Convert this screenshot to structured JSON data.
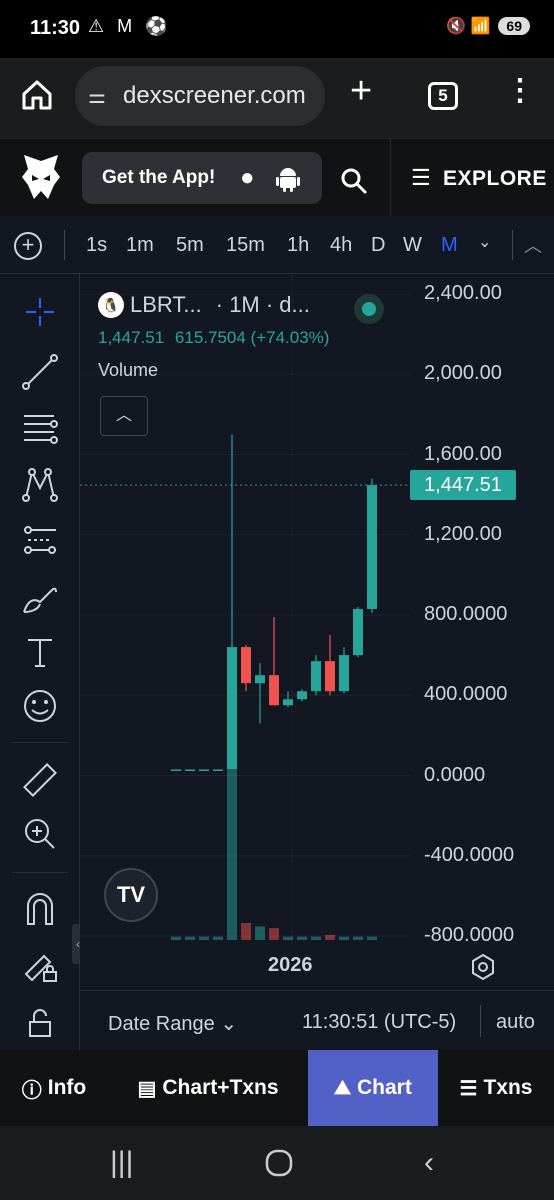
{
  "status_bar": {
    "time": "11:30",
    "notification_icons": "⚠ M ⚽",
    "right_icons": "🔇 📶",
    "network_sup": "6",
    "battery": "69"
  },
  "browser": {
    "url": "dexscreener.com",
    "tab_count": "5"
  },
  "app_header": {
    "get_app_label": "Get the App!",
    "explore_label": "EXPLORE"
  },
  "timeframes": [
    {
      "label": "1s",
      "active": false
    },
    {
      "label": "1m",
      "active": false
    },
    {
      "label": "5m",
      "active": false
    },
    {
      "label": "15m",
      "active": false
    },
    {
      "label": "1h",
      "active": false
    },
    {
      "label": "4h",
      "active": false
    },
    {
      "label": "D",
      "active": false
    },
    {
      "label": "W",
      "active": false
    },
    {
      "label": "M",
      "active": true
    }
  ],
  "legend": {
    "symbol": "LBRT...",
    "interval_text": "· 1M · d...",
    "price": "1,447.51",
    "change": "615.7504 (+74.03%)",
    "volume_label": "Volume"
  },
  "colors": {
    "up": "#26a69a",
    "down": "#ef5350",
    "background": "#131722",
    "active_tab": "#5161c6"
  },
  "chart_data": {
    "type": "candlestick",
    "price_axis_ticks": [
      "2,400.00",
      "2,000.00",
      "1,600.00",
      "1,200.00",
      "800.0000",
      "400.0000",
      "0.0000",
      "-400.0000",
      "-800.0000"
    ],
    "last_price_label": "1,447.51",
    "x_axis_label": "2026",
    "ylim": [
      -800,
      2400
    ],
    "candles": [
      {
        "o": 30,
        "h": 30,
        "l": 30,
        "c": 30
      },
      {
        "o": 30,
        "h": 30,
        "l": 30,
        "c": 30
      },
      {
        "o": 30,
        "h": 30,
        "l": 30,
        "c": 30
      },
      {
        "o": 30,
        "h": 30,
        "l": 30,
        "c": 30
      },
      {
        "o": 30,
        "h": 1700,
        "l": 30,
        "c": 640
      },
      {
        "o": 640,
        "h": 650,
        "l": 420,
        "c": 460
      },
      {
        "o": 460,
        "h": 560,
        "l": 260,
        "c": 500
      },
      {
        "o": 500,
        "h": 790,
        "l": 360,
        "c": 350
      },
      {
        "o": 350,
        "h": 420,
        "l": 340,
        "c": 380
      },
      {
        "o": 380,
        "h": 430,
        "l": 370,
        "c": 420
      },
      {
        "o": 420,
        "h": 600,
        "l": 400,
        "c": 570
      },
      {
        "o": 570,
        "h": 700,
        "l": 400,
        "c": 420
      },
      {
        "o": 420,
        "h": 640,
        "l": 410,
        "c": 600
      },
      {
        "o": 600,
        "h": 840,
        "l": 590,
        "c": 830
      },
      {
        "o": 830,
        "h": 1480,
        "l": 810,
        "c": 1447.51
      }
    ],
    "volumes": [
      {
        "v": 2,
        "up": true
      },
      {
        "v": 2,
        "up": true
      },
      {
        "v": 2,
        "up": true
      },
      {
        "v": 2,
        "up": true
      },
      {
        "v": 100,
        "up": true
      },
      {
        "v": 10,
        "up": false
      },
      {
        "v": 8,
        "up": true
      },
      {
        "v": 7,
        "up": false
      },
      {
        "v": 2,
        "up": true
      },
      {
        "v": 2,
        "up": true
      },
      {
        "v": 2,
        "up": true
      },
      {
        "v": 3,
        "up": false
      },
      {
        "v": 2,
        "up": true
      },
      {
        "v": 2,
        "up": true
      },
      {
        "v": 2,
        "up": true
      }
    ]
  },
  "chart_footer": {
    "date_range_label": "Date Range",
    "timezone": "11:30:51 (UTC-5)",
    "scale_mode": "auto"
  },
  "bottom_tabs": [
    {
      "label": "Info",
      "icon": "info-icon",
      "active": false
    },
    {
      "label": "Chart+Txns",
      "icon": "split-icon",
      "active": false
    },
    {
      "label": "Chart",
      "icon": "chart-icon",
      "active": true
    },
    {
      "label": "Txns",
      "icon": "list-icon",
      "active": false
    }
  ]
}
